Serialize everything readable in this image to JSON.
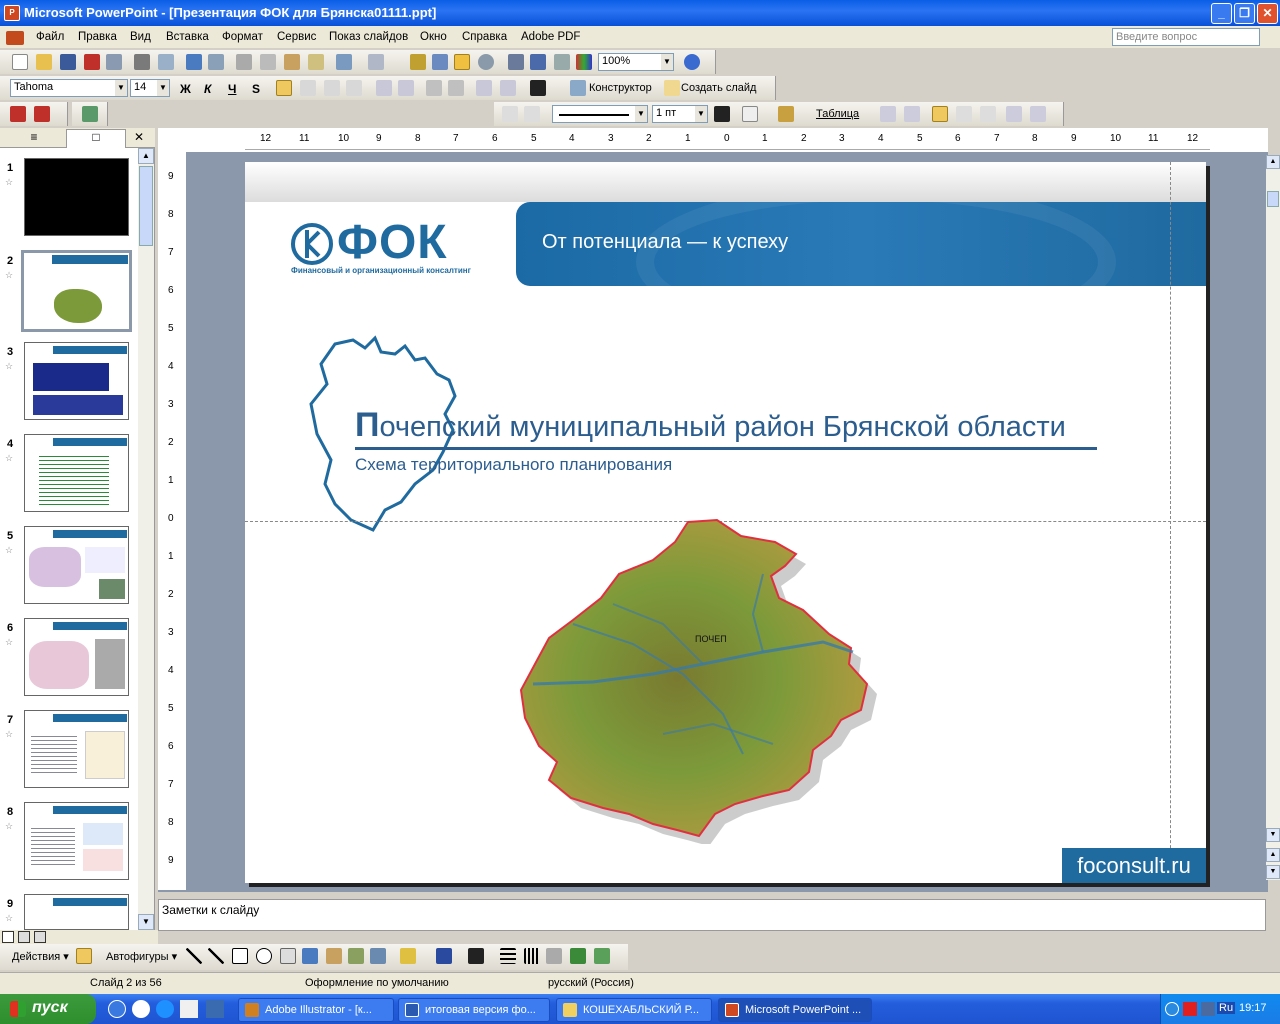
{
  "window": {
    "app_icon": "powerpoint-icon",
    "title": "Microsoft PowerPoint - [Презентация ФОК для Брянска01111.ppt]",
    "buttons": [
      "_",
      "❐",
      "✕"
    ]
  },
  "menu": {
    "items": [
      "Файл",
      "Правка",
      "Вид",
      "Вставка",
      "Формат",
      "Сервис",
      "Показ слайдов",
      "Окно",
      "Справка",
      "Adobe PDF"
    ],
    "ask_placeholder": "Введите вопрос"
  },
  "toolbar_standard": {
    "zoom": "100%"
  },
  "toolbar_format": {
    "font": "Tahoma",
    "size": "14",
    "bold": "Ж",
    "italic": "К",
    "underline": "Ч",
    "shadow": "S",
    "designer": "Конструктор",
    "new_slide": "Создать слайд"
  },
  "toolbar_tables": {
    "line_width": "1 пт",
    "table": "Таблица"
  },
  "slides_panel": {
    "tab_outline": "≡",
    "tab_slides": "□",
    "close": "✕",
    "numbers": [
      "1",
      "2",
      "3",
      "4",
      "5",
      "6",
      "7",
      "8",
      "9"
    ]
  },
  "ruler": {
    "h_ticks": [
      "12",
      "11",
      "10",
      "9",
      "8",
      "7",
      "6",
      "5",
      "4",
      "3",
      "2",
      "1",
      "0",
      "1",
      "2",
      "3",
      "4",
      "5",
      "6",
      "7",
      "8",
      "9",
      "10",
      "11",
      "12"
    ],
    "v_ticks": [
      "9",
      "8",
      "7",
      "6",
      "5",
      "4",
      "3",
      "2",
      "1",
      "0",
      "1",
      "2",
      "3",
      "4",
      "5",
      "6",
      "7",
      "8",
      "9"
    ]
  },
  "slide": {
    "logo": "ФОК",
    "logo_sub": "Финансовый и организационный консалтинг",
    "tagline": "От потенциала — к успеху",
    "title_first": "П",
    "title_rest": "очепский муниципальный район Брянской области",
    "subtitle": "Схема территориального планирования",
    "map_label": "ПОЧЕП",
    "site": "foconsult.ru",
    "colors": {
      "brand_blue": "#1f6a9f",
      "title_blue": "#2b5d8f",
      "map_green": "#7c9a3a",
      "map_outline": "#e03040"
    }
  },
  "notes": {
    "placeholder": "Заметки к слайду"
  },
  "drawing": {
    "actions": "Действия",
    "autoshapes": "Автофигуры"
  },
  "status": {
    "slide": "Слайд 2 из 56",
    "design": "Оформление по умолчанию",
    "lang": "русский (Россия)"
  },
  "taskbar": {
    "start": "пуск",
    "tasks": [
      {
        "label": "Adobe Illustrator - [к...",
        "icon": "illustrator-icon"
      },
      {
        "label": "итоговая версия фо...",
        "icon": "word-icon"
      },
      {
        "label": "КОШЕХАБЛЬСКИЙ Р...",
        "icon": "folder-icon"
      },
      {
        "label": "Microsoft PowerPoint ...",
        "icon": "powerpoint-icon"
      }
    ],
    "lang": "Ru",
    "time": "19:17"
  }
}
